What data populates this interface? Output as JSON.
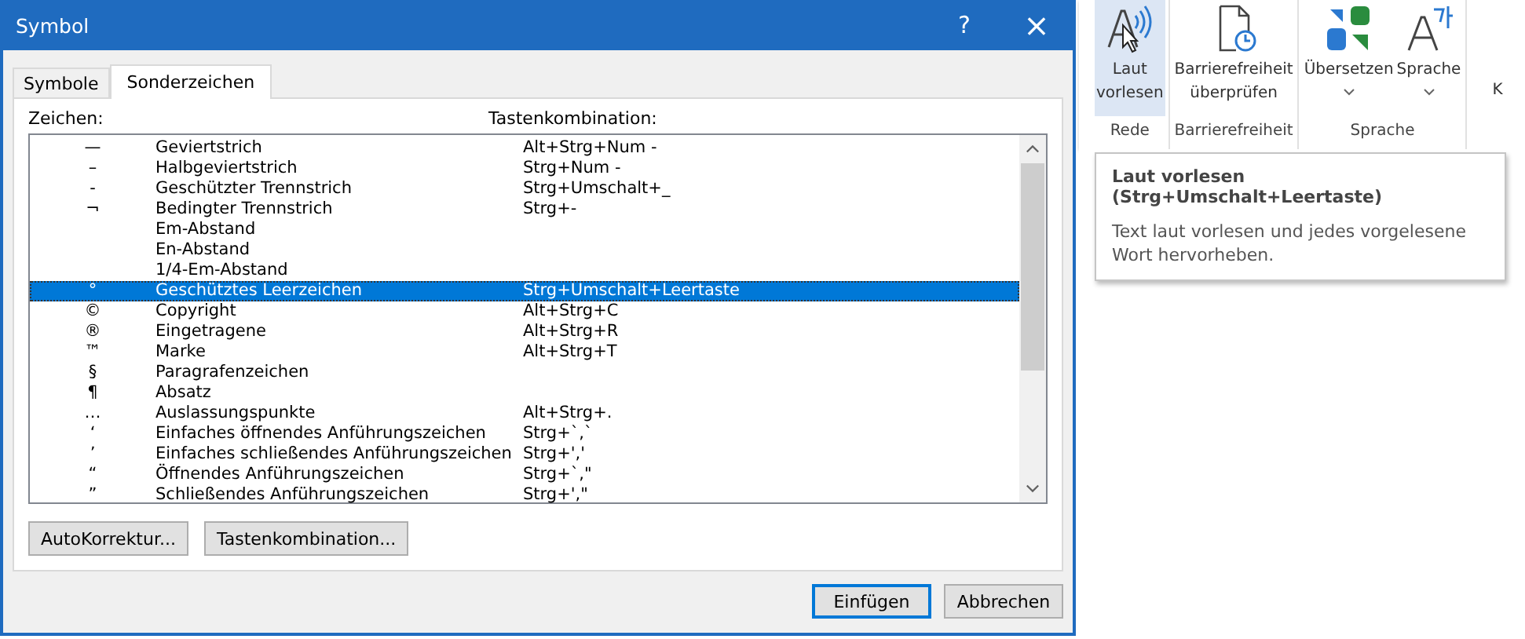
{
  "dialog": {
    "title": "Symbol",
    "help_button": "?",
    "close_button": "×",
    "tabs": [
      {
        "label": "Symbole",
        "selected": false
      },
      {
        "label": "Sonderzeichen",
        "selected": true
      }
    ],
    "list": {
      "columns": [
        "Zeichen:",
        "Tastenkombination:"
      ],
      "rows": [
        {
          "char": "—",
          "name": "Geviertstrich",
          "shortcut": "Alt+Strg+Num -",
          "selected": false
        },
        {
          "char": "–",
          "name": "Halbgeviertstrich",
          "shortcut": "Strg+Num -",
          "selected": false
        },
        {
          "char": "-",
          "name": "Geschützter Trennstrich",
          "shortcut": "Strg+Umschalt+_",
          "selected": false
        },
        {
          "char": "¬",
          "name": "Bedingter Trennstrich",
          "shortcut": "Strg+-",
          "selected": false
        },
        {
          "name": "Em-Abstand",
          "selected": false
        },
        {
          "name": "En-Abstand",
          "selected": false
        },
        {
          "name": "1/4-Em-Abstand",
          "selected": false
        },
        {
          "char": "°",
          "name": "Geschütztes Leerzeichen",
          "shortcut": "Strg+Umschalt+Leertaste",
          "selected": true
        },
        {
          "char": "©",
          "name": "Copyright",
          "shortcut": "Alt+Strg+C",
          "selected": false
        },
        {
          "char": "®",
          "name": "Eingetragene",
          "shortcut": "Alt+Strg+R",
          "selected": false
        },
        {
          "char": "™",
          "name": "Marke",
          "shortcut": "Alt+Strg+T",
          "selected": false
        },
        {
          "char": "§",
          "name": "Paragrafenzeichen",
          "selected": false
        },
        {
          "char": "¶",
          "name": "Absatz",
          "selected": false
        },
        {
          "char": "…",
          "name": "Auslassungspunkte",
          "shortcut": "Alt+Strg+.",
          "selected": false
        },
        {
          "char": "‘",
          "name": "Einfaches öffnendes Anführungszeichen",
          "shortcut": "Strg+`,`",
          "selected": false
        },
        {
          "char": "’",
          "name": "Einfaches schließendes Anführungszeichen",
          "shortcut": "Strg+','",
          "selected": false
        },
        {
          "char": "“",
          "name": "Öffnendes Anführungszeichen",
          "shortcut": "Strg+`,\"",
          "selected": false
        },
        {
          "char": "”",
          "name": "Schließendes Anführungszeichen",
          "shortcut": "Strg+',\"",
          "selected": false
        }
      ]
    },
    "panel_buttons": [
      "AutoKorrektur...",
      "Tastenkombination..."
    ],
    "buttons": [
      {
        "label": "Einfügen",
        "default": true
      },
      {
        "label": "Abbrechen",
        "default": false
      }
    ]
  },
  "ribbon": {
    "groups": [
      {
        "label": "Rede",
        "buttons": [
          {
            "kind": "speak",
            "label_lines": [
              "Laut",
              "vorlesen"
            ],
            "selected": true,
            "dropdown": false
          }
        ]
      },
      {
        "label": "Barrierefreiheit",
        "buttons": [
          {
            "kind": "check",
            "label_lines": [
              "Barrierefreiheit",
              "überprüfen"
            ],
            "selected": false,
            "dropdown": false
          }
        ]
      },
      {
        "label": "Sprache",
        "buttons": [
          {
            "kind": "translate",
            "label_lines": [
              "Übersetzen"
            ],
            "selected": false,
            "dropdown": true
          },
          {
            "kind": "language",
            "label_lines": [
              "Sprache"
            ],
            "selected": false,
            "dropdown": true
          }
        ]
      }
    ],
    "column_4": "K"
  },
  "tooltip": {
    "title": "Laut vorlesen (Strg+Umschalt+Leertaste)",
    "text": "Text laut vorlesen und jedes vorgelesene Wort hervorheben."
  }
}
